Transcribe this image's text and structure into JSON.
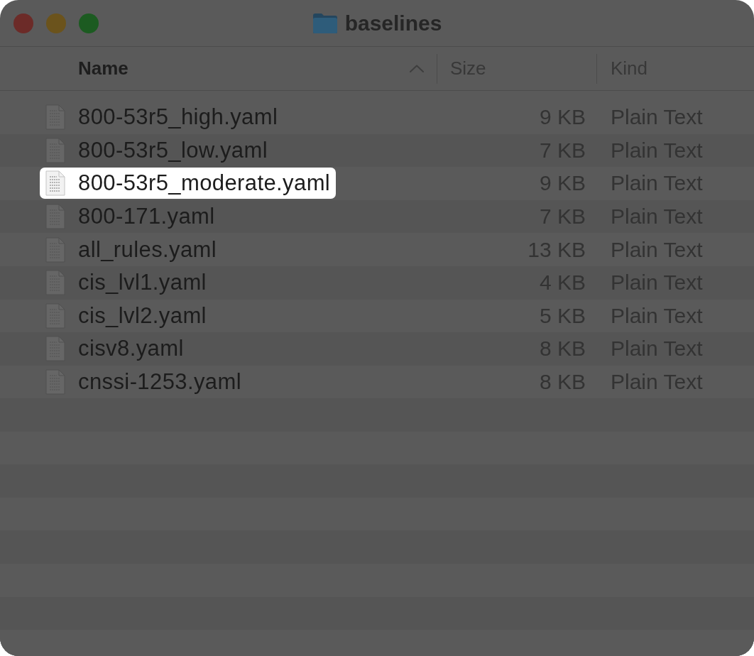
{
  "window": {
    "title": "baselines"
  },
  "columns": [
    {
      "label": "Name",
      "sorted": true
    },
    {
      "label": "Size",
      "sorted": false
    },
    {
      "label": "Kind",
      "sorted": false
    }
  ],
  "files": [
    {
      "name": "800-53r5_high.yaml",
      "size": "9 KB",
      "file_type": "Plain Text",
      "highlighted": false
    },
    {
      "name": "800-53r5_low.yaml",
      "size": "7 KB",
      "file_type": "Plain Text",
      "highlighted": false
    },
    {
      "name": "800-53r5_moderate.yaml",
      "size": "9 KB",
      "file_type": "Plain Text",
      "highlighted": true
    },
    {
      "name": "800-171.yaml",
      "size": "7 KB",
      "file_type": "Plain Text",
      "highlighted": false
    },
    {
      "name": "all_rules.yaml",
      "size": "13 KB",
      "file_type": "Plain Text",
      "highlighted": false
    },
    {
      "name": "cis_lvl1.yaml",
      "size": "4 KB",
      "file_type": "Plain Text",
      "highlighted": false
    },
    {
      "name": "cis_lvl2.yaml",
      "size": "5 KB",
      "file_type": "Plain Text",
      "highlighted": false
    },
    {
      "name": "cisv8.yaml",
      "size": "8 KB",
      "file_type": "Plain Text",
      "highlighted": false
    },
    {
      "name": "cnssi-1253.yaml",
      "size": "8 KB",
      "file_type": "Plain Text",
      "highlighted": false
    }
  ]
}
